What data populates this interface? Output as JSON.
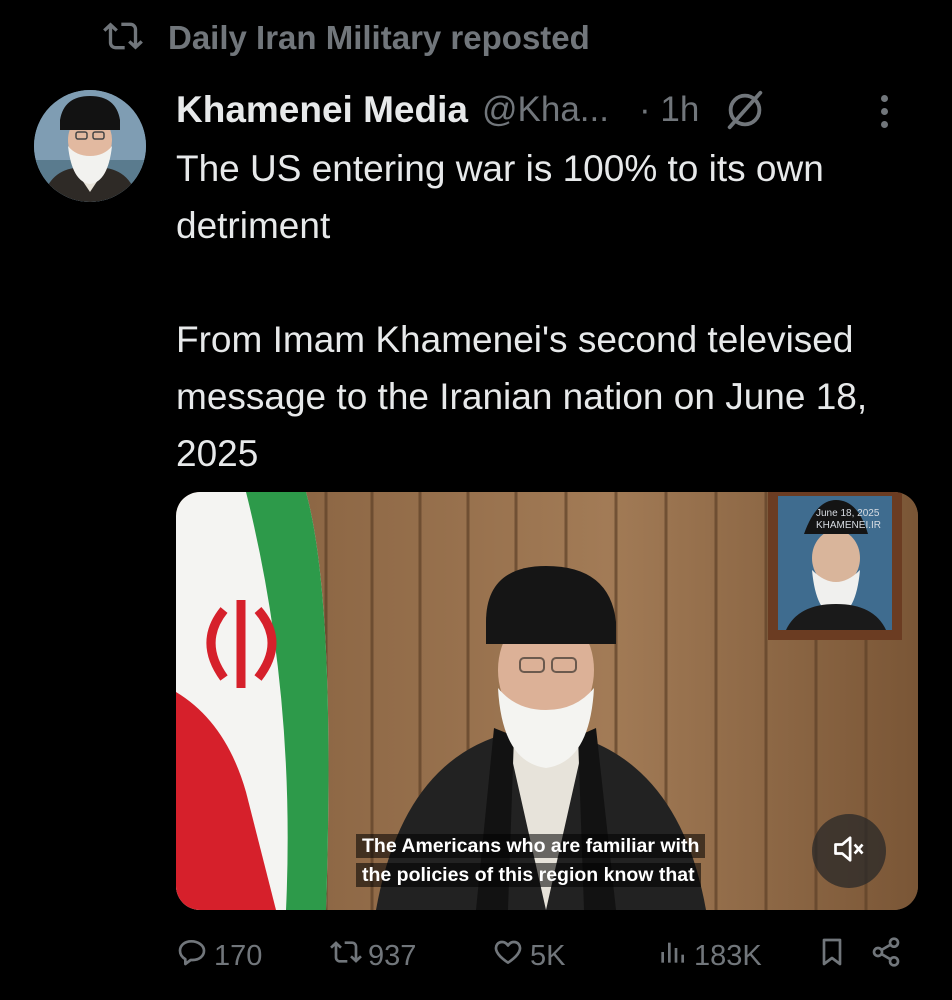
{
  "repost": {
    "label": "Daily Iran Military reposted",
    "icon": "repost-icon"
  },
  "tweet": {
    "author_name": "Khamenei Media",
    "handle": "@Kha...",
    "timestamp": "· 1h",
    "paragraph_1": "The US entering war is 100% to its own detriment",
    "paragraph_2": "From Imam Khamenei's second televised message to the Iranian nation on June 18, 2025"
  },
  "media": {
    "caption_line_1": "The Americans who are familiar with",
    "caption_line_2": "the policies of this region know that",
    "watermark_date": "June 18, 2025",
    "watermark_site": "KHAMENEI.IR"
  },
  "actions": {
    "replies": "170",
    "reposts": "937",
    "likes": "5K",
    "views": "183K"
  },
  "colors": {
    "background": "#000000",
    "primary_text": "#e7e9ea",
    "secondary_text": "#71767b"
  }
}
